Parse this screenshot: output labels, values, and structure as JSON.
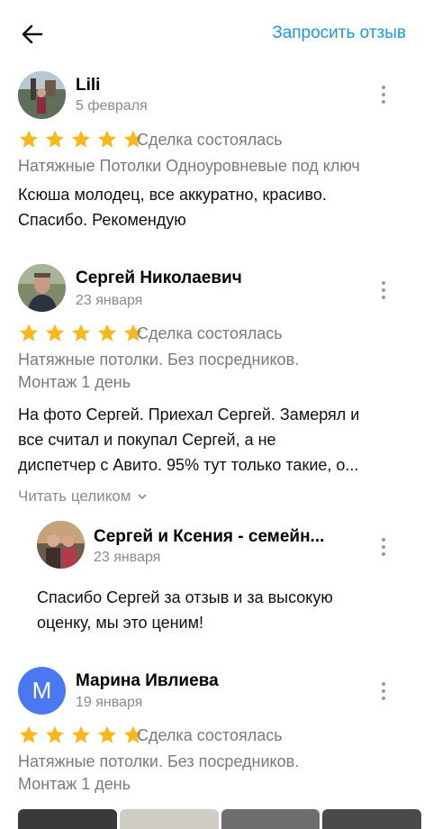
{
  "header": {
    "back_icon": "arrow-left-icon",
    "request_label": "Запросить отзыв",
    "accent_color": "#1a9ad6"
  },
  "reviews": [
    {
      "author": "Lili",
      "date": "5 февраля",
      "rating": 5,
      "deal_status": "Сделка состоялась",
      "service": "Натяжные Потолки Одноуровневые под ключ",
      "text_lines": [
        "Ксюша молодец, все аккуратно, красиво.",
        "Спасибо. Рекомендую"
      ]
    },
    {
      "author": "Сергей Николаевич",
      "date": "23 января",
      "rating": 5,
      "deal_status": "Сделка состоялась",
      "service_lines": [
        "Натяжные потолки. Без посредников.",
        "Монтаж 1 день"
      ],
      "text_lines": [
        "На фото Сергей. Приехал Сергей. Замерял и",
        "все считал и покупал Сергей,  а не",
        "диспетчер с Авито. 95% тут только такие, о..."
      ],
      "read_more": "Читать целиком",
      "reply": {
        "author": "Сергей и Ксения - семейн...",
        "date": "23 января",
        "text_lines": [
          "Спасибо Сергей за отзыв и за высокую",
          "оценку, мы это ценим!"
        ]
      }
    },
    {
      "author": "Марина Ивлиева",
      "avatar_letter": "М",
      "date": "19 января",
      "rating": 5,
      "deal_status": "Сделка состоялась",
      "service_lines": [
        "Натяжные потолки. Без посредников.",
        "Монтаж 1 день"
      ]
    }
  ],
  "colors": {
    "star": "#f8b71c",
    "muted_text": "#7a7a7a",
    "avatar_letter_bg": "#4a78f0"
  }
}
